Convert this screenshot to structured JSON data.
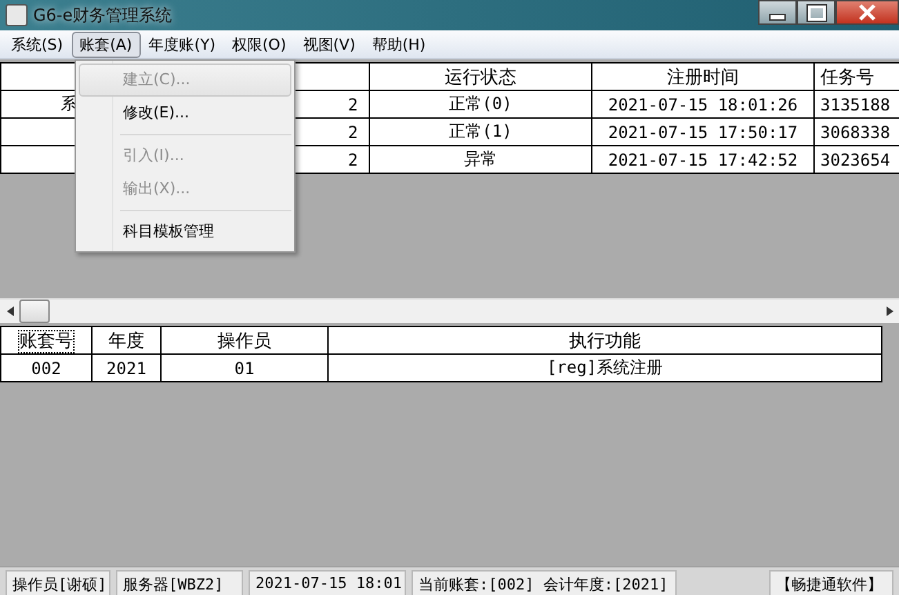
{
  "window": {
    "title": "G6-e财务管理系统"
  },
  "menu_bar": [
    {
      "label": "系统(S)",
      "selected": false
    },
    {
      "label": "账套(A)",
      "selected": true
    },
    {
      "label": "年度账(Y)",
      "selected": false
    },
    {
      "label": "权限(O)",
      "selected": false
    },
    {
      "label": "视图(V)",
      "selected": false
    },
    {
      "label": "帮助(H)",
      "selected": false
    }
  ],
  "dropdown": [
    {
      "kind": "item",
      "label": "建立(C)...",
      "disabled": true,
      "selected": true
    },
    {
      "kind": "item",
      "label": "修改(E)...",
      "disabled": false,
      "selected": false
    },
    {
      "kind": "separator"
    },
    {
      "kind": "item",
      "label": "引入(I)...",
      "disabled": true,
      "selected": false
    },
    {
      "kind": "item",
      "label": "输出(X)...",
      "disabled": true,
      "selected": false
    },
    {
      "kind": "separator"
    },
    {
      "kind": "item",
      "label": "科目模板管理",
      "disabled": false,
      "selected": false
    }
  ],
  "task_table": {
    "columns": [
      "",
      "",
      "运行状态",
      "注册时间",
      "任务号"
    ],
    "rows": [
      [
        "系",
        "2",
        "正常(0)",
        "2021-07-15 18:01:26",
        "3135188"
      ],
      [
        "",
        "2",
        "正常(1)",
        "2021-07-15 17:50:17",
        "3068338"
      ],
      [
        "",
        "2",
        "异常",
        "2021-07-15 17:42:52",
        "3023654"
      ]
    ]
  },
  "log_table": {
    "columns": [
      "账套号",
      "年度",
      "操作员",
      "执行功能"
    ],
    "rows": [
      [
        "002",
        "2021",
        "01",
        "[reg]系统注册"
      ]
    ]
  },
  "status_bar": [
    "操作员[谢硕]",
    "服务器[WBZ2]",
    "2021-07-15 18:01",
    "当前账套:[002] 会计年度:[2021]",
    "【畅捷通软件】"
  ]
}
